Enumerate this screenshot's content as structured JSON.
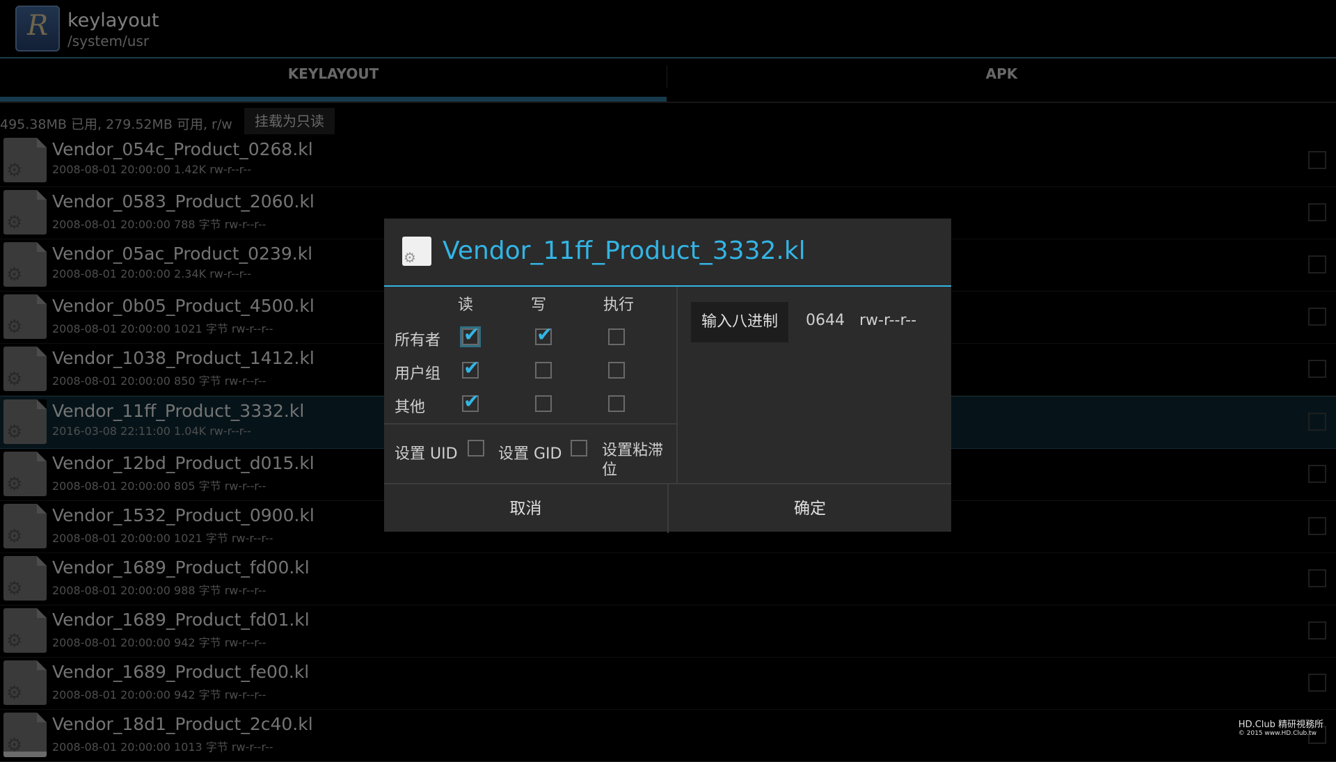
{
  "actionbar": {
    "title": "keylayout",
    "subtitle": "/system/usr",
    "app_icon": "R"
  },
  "tabs": [
    {
      "label": "KEYLAYOUT",
      "active": true
    },
    {
      "label": "APK",
      "active": false
    }
  ],
  "storage": {
    "info": "495.38MB 已用, 279.52MB 可用, r/w",
    "mount_button": "挂载为只读"
  },
  "files": [
    {
      "name": "Vendor_054c_Product_0268.kl",
      "meta": "2008-08-01 20:00:00  1.42K  rw-r--r--"
    },
    {
      "name": "Vendor_0583_Product_2060.kl",
      "meta": "2008-08-01 20:00:00  788 字节  rw-r--r--"
    },
    {
      "name": "Vendor_05ac_Product_0239.kl",
      "meta": "2008-08-01 20:00:00  2.34K  rw-r--r--"
    },
    {
      "name": "Vendor_0b05_Product_4500.kl",
      "meta": "2008-08-01 20:00:00  1021 字节  rw-r--r--"
    },
    {
      "name": "Vendor_1038_Product_1412.kl",
      "meta": "2008-08-01 20:00:00  850 字节  rw-r--r--"
    },
    {
      "name": "Vendor_11ff_Product_3332.kl",
      "meta": "2016-03-08 22:11:00  1.04K  rw-r--r--",
      "selected": true
    },
    {
      "name": "Vendor_12bd_Product_d015.kl",
      "meta": "2008-08-01 20:00:00  805 字节  rw-r--r--"
    },
    {
      "name": "Vendor_1532_Product_0900.kl",
      "meta": "2008-08-01 20:00:00  1021 字节  rw-r--r--"
    },
    {
      "name": "Vendor_1689_Product_fd00.kl",
      "meta": "2008-08-01 20:00:00  988 字节  rw-r--r--"
    },
    {
      "name": "Vendor_1689_Product_fd01.kl",
      "meta": "2008-08-01 20:00:00  942 字节  rw-r--r--"
    },
    {
      "name": "Vendor_1689_Product_fe00.kl",
      "meta": "2008-08-01 20:00:00  942 字节  rw-r--r--"
    },
    {
      "name": "Vendor_18d1_Product_2c40.kl",
      "meta": "2008-08-01 20:00:00  1013 字节  rw-r--r--"
    }
  ],
  "dialog": {
    "title": "Vendor_11ff_Product_3332.kl",
    "columns": {
      "read": "读",
      "write": "写",
      "execute": "执行"
    },
    "rows": {
      "owner": "所有者",
      "group": "用户组",
      "other": "其他"
    },
    "permissions": {
      "owner": {
        "read": true,
        "write": true,
        "execute": false
      },
      "group": {
        "read": true,
        "write": false,
        "execute": false
      },
      "other": {
        "read": true,
        "write": false,
        "execute": false
      }
    },
    "special": {
      "setuid": "设置 UID",
      "setgid": "设置 GID",
      "sticky": "设置粘滞位"
    },
    "octal_button": "输入八进制",
    "octal_value": "0644",
    "permission_string": "rw-r--r--",
    "cancel": "取消",
    "confirm": "确定"
  },
  "watermark": {
    "line1": "HD.Club 精研視務所",
    "line2": "© 2015  www.HD.Club.tw"
  },
  "colors": {
    "accent": "#33b5e5",
    "tab_indicator": "#2a6b8b",
    "dialog_bg": "#2b2b2b"
  }
}
